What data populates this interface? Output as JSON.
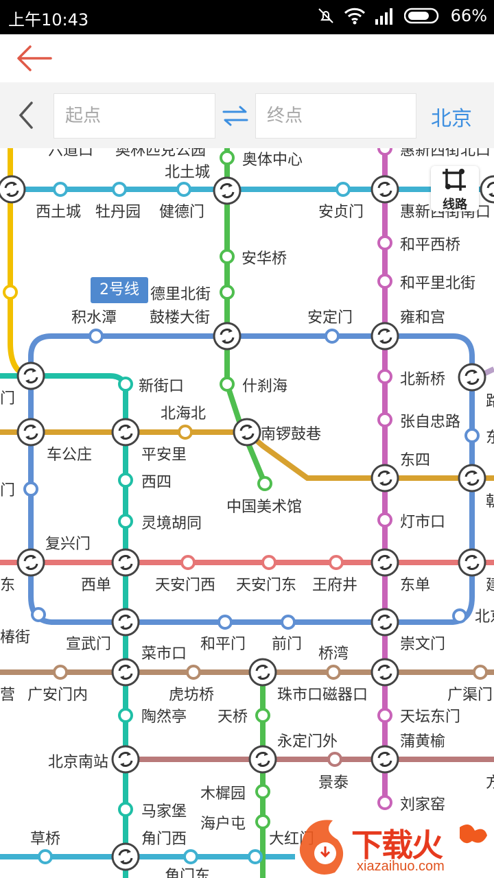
{
  "status_bar": {
    "time": "上午10:43",
    "battery": "66%"
  },
  "search": {
    "start_placeholder": "起点",
    "end_placeholder": "终点",
    "city": "北京"
  },
  "route_button": {
    "label": "线路"
  },
  "line_tag": {
    "label": "2号线"
  },
  "colors": {
    "line2": "#5f8fd3",
    "line8": "#4fbe4f",
    "line5": "#c863b8",
    "line4": "#1fbfa6",
    "line10": "#3fb1d1",
    "line6": "#d7a12f",
    "line1": "#e67676",
    "line7": "#b58c6d",
    "line14": "#b97a7a",
    "line13": "#f2c000",
    "accent": "#3d8fe0"
  },
  "stations": [
    {
      "id": "s_aoti",
      "name": "奥体中心"
    },
    {
      "id": "s_beitucheng",
      "name": "北土城"
    },
    {
      "id": "s_xitucheng",
      "name": "西土城"
    },
    {
      "id": "s_mudanyuan",
      "name": "牡丹园"
    },
    {
      "id": "s_jiandemen",
      "name": "健德门"
    },
    {
      "id": "s_anzhenmen",
      "name": "安贞门"
    },
    {
      "id": "s_huixinxijienan",
      "name": "惠新西街南口"
    },
    {
      "id": "s_anhuaqiao",
      "name": "安华桥"
    },
    {
      "id": "s_hepingxiqiao",
      "name": "和平西桥"
    },
    {
      "id": "s_hepinglibeijie",
      "name": "和平里北街"
    },
    {
      "id": "s_delibeijie",
      "name": "德里北街"
    },
    {
      "id": "s_jishuitan",
      "name": "积水潭"
    },
    {
      "id": "s_gulou",
      "name": "鼓楼大街"
    },
    {
      "id": "s_andingmen",
      "name": "安定门"
    },
    {
      "id": "s_yonghegong",
      "name": "雍和宫"
    },
    {
      "id": "s_xinjiekou",
      "name": "新街口"
    },
    {
      "id": "s_shichahai",
      "name": "什刹海"
    },
    {
      "id": "s_beixinqiao",
      "name": "北新桥"
    },
    {
      "id": "s_beihaibei",
      "name": "北海北"
    },
    {
      "id": "s_nanluoguxiang",
      "name": "南锣鼓巷"
    },
    {
      "id": "s_zhangzizhong",
      "name": "张自忠路"
    },
    {
      "id": "s_chegongzhuang",
      "name": "车公庄"
    },
    {
      "id": "s_pinganli",
      "name": "平安里"
    },
    {
      "id": "s_dongsi",
      "name": "东四"
    },
    {
      "id": "s_xisi",
      "name": "西四"
    },
    {
      "id": "s_meishuguan",
      "name": "中国美术馆"
    },
    {
      "id": "s_lingjing",
      "name": "灵境胡同"
    },
    {
      "id": "s_dengshikou",
      "name": "灯市口"
    },
    {
      "id": "s_fuxingmen",
      "name": "复兴门"
    },
    {
      "id": "s_xidan",
      "name": "西单"
    },
    {
      "id": "s_tiananmenxi",
      "name": "天安门西"
    },
    {
      "id": "s_tiananmendong",
      "name": "天安门东"
    },
    {
      "id": "s_wangfujing",
      "name": "王府井"
    },
    {
      "id": "s_dongdan",
      "name": "东单"
    },
    {
      "id": "s_changchunjie",
      "name": "椿街"
    },
    {
      "id": "s_xuanwumen",
      "name": "宣武门"
    },
    {
      "id": "s_hepingmen",
      "name": "和平门"
    },
    {
      "id": "s_qianmen",
      "name": "前门"
    },
    {
      "id": "s_chongwenmen",
      "name": "崇文门"
    },
    {
      "id": "s_caishikou",
      "name": "菜市口"
    },
    {
      "id": "s_qiaowan",
      "name": "桥湾"
    },
    {
      "id": "s_ying",
      "name": "营"
    },
    {
      "id": "s_guanganmennei",
      "name": "广安门内"
    },
    {
      "id": "s_hufangqiao",
      "name": "虎坊桥"
    },
    {
      "id": "s_zhushikou",
      "name": "珠市口"
    },
    {
      "id": "s_ciqikou",
      "name": "磁器口"
    },
    {
      "id": "s_guangqumen",
      "name": "广渠门"
    },
    {
      "id": "s_taoranting",
      "name": "陶然亭"
    },
    {
      "id": "s_tianqiao",
      "name": "天桥"
    },
    {
      "id": "s_tiantandongmen",
      "name": "天坛东门"
    },
    {
      "id": "s_yongdingmenwai",
      "name": "永定门外"
    },
    {
      "id": "s_puhuangyu",
      "name": "蒲黄榆"
    },
    {
      "id": "s_beijingnan",
      "name": "北京南站"
    },
    {
      "id": "s_jingtai",
      "name": "景泰"
    },
    {
      "id": "s_muxiyuan",
      "name": "木樨园"
    },
    {
      "id": "s_majiapu",
      "name": "马家堡"
    },
    {
      "id": "s_liujiayao",
      "name": "刘家窑"
    },
    {
      "id": "s_haihutun",
      "name": "海户屯"
    },
    {
      "id": "s_caoqiao",
      "name": "草桥"
    },
    {
      "id": "s_jiaomenxi",
      "name": "角门西"
    }
  ],
  "partial_labels": [
    {
      "id": "p_liudaokou",
      "name": "六道口"
    },
    {
      "id": "p_aolinpike",
      "name": "奥林匹克公园"
    },
    {
      "id": "p_huixinxijiebei",
      "name": "惠新西街北口"
    },
    {
      "id": "p_men1",
      "name": "门"
    },
    {
      "id": "p_men2",
      "name": "门"
    },
    {
      "id": "p_lu",
      "name": "路"
    },
    {
      "id": "p_dong1",
      "name": "东"
    },
    {
      "id": "p_dong2",
      "name": "东"
    },
    {
      "id": "p_chao",
      "name": "朝"
    },
    {
      "id": "p_jian",
      "name": "建"
    },
    {
      "id": "p_bei",
      "name": "北京"
    },
    {
      "id": "p_fang",
      "name": "方"
    },
    {
      "id": "p_dahong",
      "name": "大红门"
    },
    {
      "id": "p_jiaomendong",
      "name": "角门东"
    }
  ],
  "watermark": {
    "brand": "下载火",
    "domain": "xiazaihuo.com"
  }
}
